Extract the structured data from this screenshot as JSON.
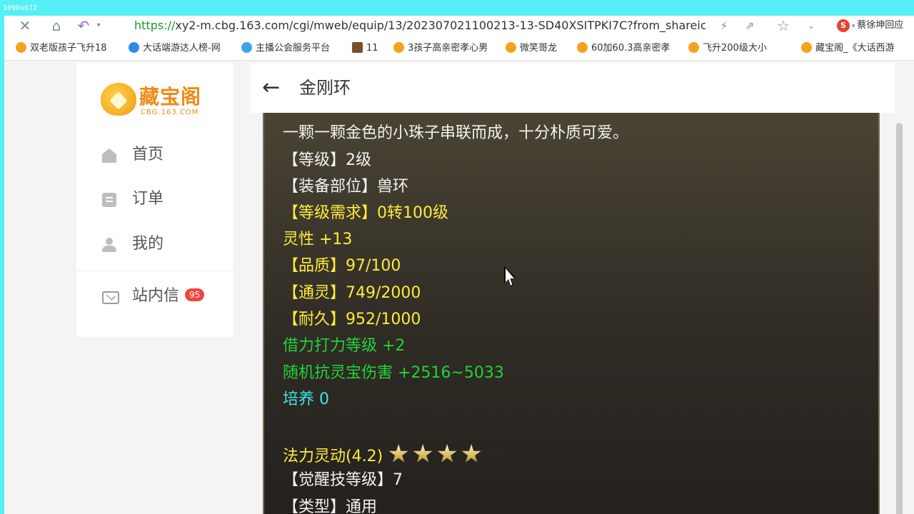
{
  "overlay": {
    "resolution_label": "1090x612"
  },
  "browser": {
    "url_protocol": "https://",
    "url_rest": "xy2-m.cbg.163.com/cgi/mweb/equip/13/202307021100213-13-SD40XSITPKI7C?from_shareic",
    "user_name": "蔡徐坤回应",
    "search_engine_logo": "S",
    "icons": [
      "close-icon",
      "home-icon",
      "undo-icon",
      "chevron-down-icon",
      "lightning-icon",
      "share-icon",
      "star-icon",
      "chevron-down-icon"
    ]
  },
  "bookmarks": [
    {
      "label": "双老版孩子飞升18",
      "icon": "gold-ingot"
    },
    {
      "label": "大话端游达人榜-网",
      "icon": "blue-e"
    },
    {
      "label": "主播公会服务平台",
      "icon": "sky-badge"
    },
    {
      "label": "11",
      "icon": "game-tile"
    },
    {
      "label": "3孩子高亲密孝心男",
      "icon": "gold-ingot"
    },
    {
      "label": "微笑哥龙",
      "icon": "gold-ingot"
    },
    {
      "label": "60加60.3高亲密孝",
      "icon": "gold-ingot"
    },
    {
      "label": "飞升200级大小",
      "icon": "gold-ingot"
    },
    {
      "label": "藏宝阁_《大话西游",
      "icon": "gold-ingot"
    }
  ],
  "sidebar": {
    "logo_name": "藏宝阁",
    "logo_sub": "CBG.163.COM",
    "items": [
      {
        "label": "首页",
        "icon": "home-icon"
      },
      {
        "label": "订单",
        "icon": "order-icon"
      },
      {
        "label": "我的",
        "icon": "user-icon"
      }
    ],
    "messages": {
      "label": "站内信",
      "badge": "95",
      "icon": "mail-icon"
    }
  },
  "main": {
    "title": "金刚环",
    "details": [
      {
        "text": "一颗一颗金色的小珠子串联而成，十分朴质可爱。",
        "color": "white"
      },
      {
        "text": "【等级】2级",
        "color": "white"
      },
      {
        "text": "【装备部位】兽环",
        "color": "white"
      },
      {
        "text": "【等级需求】0转100级",
        "color": "yellow"
      },
      {
        "text": "灵性 +13",
        "color": "yellow"
      },
      {
        "text": "【品质】97/100",
        "color": "yellow"
      },
      {
        "text": "【通灵】749/2000",
        "color": "yellow"
      },
      {
        "text": "【耐久】952/1000",
        "color": "yellow"
      },
      {
        "text": "借力打力等级 +2",
        "color": "green"
      },
      {
        "text": "随机抗灵宝伤害 +2516~5033",
        "color": "green"
      },
      {
        "text": "培养 0",
        "color": "cyan"
      }
    ],
    "skill": {
      "name": "法力灵动(4.2)",
      "stars_filled": 4,
      "stars_total": 5
    },
    "awaken_level": "【觉醒技等级】7",
    "type_line": "【类型】通用"
  }
}
